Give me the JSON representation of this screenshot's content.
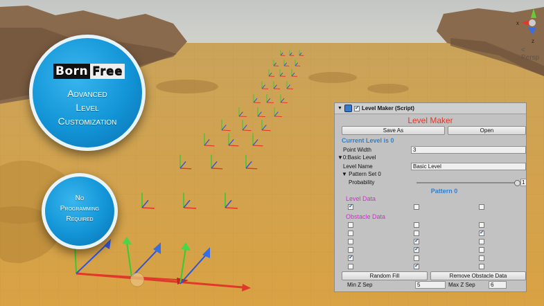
{
  "colors": {
    "sky": "#c9ccc9",
    "ground": "#d39e41",
    "accent_blue": "#1294d6",
    "level_maker_title": "#e0382b",
    "section_blue": "#2f7fd0",
    "magenta": "#c832c8"
  },
  "promo": {
    "brand_part1": "Born",
    "brand_part2": "Free",
    "bubble1_lines": [
      "Advanced",
      "Level",
      "Customization"
    ],
    "bubble2_lines": [
      "No",
      "Programming",
      "Required"
    ]
  },
  "scene": {
    "perspective_label": "< Persp",
    "gizmo_axes": [
      "x",
      "y",
      "z"
    ]
  },
  "inspector": {
    "component_title": "Level Maker (Script)",
    "component_icon": "script-icon",
    "title": "Level Maker",
    "save_as_label": "Save As",
    "open_label": "Open",
    "current_level": "Current Level is 0",
    "point_width_label": "Point Width",
    "point_width_value": "3",
    "level_foldout": "0:Basic Level",
    "level_name_label": "Level Name",
    "level_name_value": "Basic Level",
    "pattern_set_foldout": "Pattern Set 0",
    "probability_label": "Probability",
    "probability_value": "1",
    "probability_fraction": 1.0,
    "pattern_title": "Pattern 0",
    "level_data_label": "Level Data",
    "level_data": [
      [
        true,
        false,
        false
      ]
    ],
    "obstacle_data_label": "Obstacle Data",
    "obstacle_data": [
      [
        false,
        false,
        false
      ],
      [
        false,
        false,
        true
      ],
      [
        false,
        true,
        false
      ],
      [
        false,
        true,
        false
      ],
      [
        true,
        false,
        false
      ],
      [
        false,
        true,
        false
      ]
    ],
    "random_fill_label": "Random Fill",
    "remove_obstacle_label": "Remove Obstacle Data",
    "min_z_label": "Min Z Sep",
    "min_z_value": "5",
    "max_z_label": "Max Z Sep",
    "max_z_value": "6"
  }
}
